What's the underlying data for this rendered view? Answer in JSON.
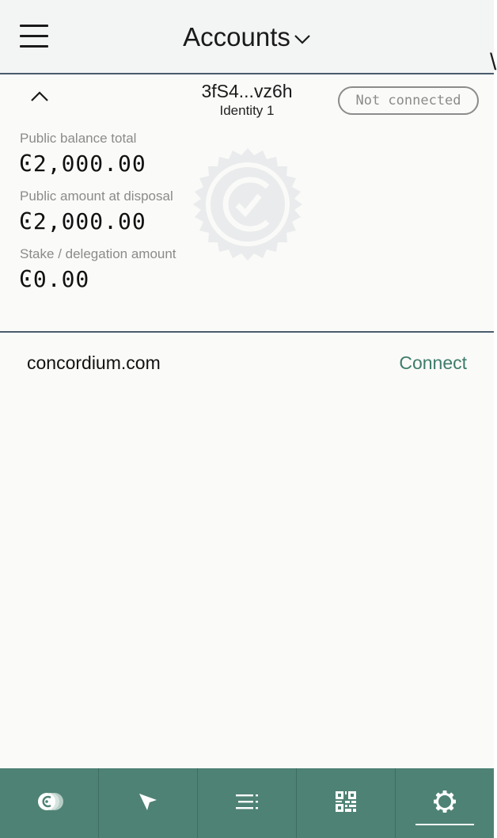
{
  "header": {
    "title": "Accounts",
    "menu_icon": "hamburger-menu-icon",
    "dropdown_icon": "chevron-down-icon"
  },
  "account": {
    "address": "3fS4...vz6h",
    "identity": "Identity 1",
    "status": "Not connected",
    "balances": [
      {
        "label": "Public balance total",
        "value": "Ͼ2,000.00"
      },
      {
        "label": "Public amount at disposal",
        "value": "Ͼ2,000.00"
      },
      {
        "label": "Stake / delegation amount",
        "value": "Ͼ0.00"
      }
    ]
  },
  "site": {
    "name": "concordium.com",
    "connect_label": "Connect"
  },
  "bottom_nav": {
    "tabs": [
      {
        "icon": "accounts-icon",
        "active": false
      },
      {
        "icon": "send-icon",
        "active": false
      },
      {
        "icon": "transaction-list-icon",
        "active": false
      },
      {
        "icon": "qr-code-icon",
        "active": false
      },
      {
        "icon": "settings-gear-icon",
        "active": true
      }
    ]
  },
  "colors": {
    "accent": "#4e8274",
    "connect": "#3e7c6b",
    "divider": "#4a5c6c",
    "muted": "#8b8b8b"
  }
}
